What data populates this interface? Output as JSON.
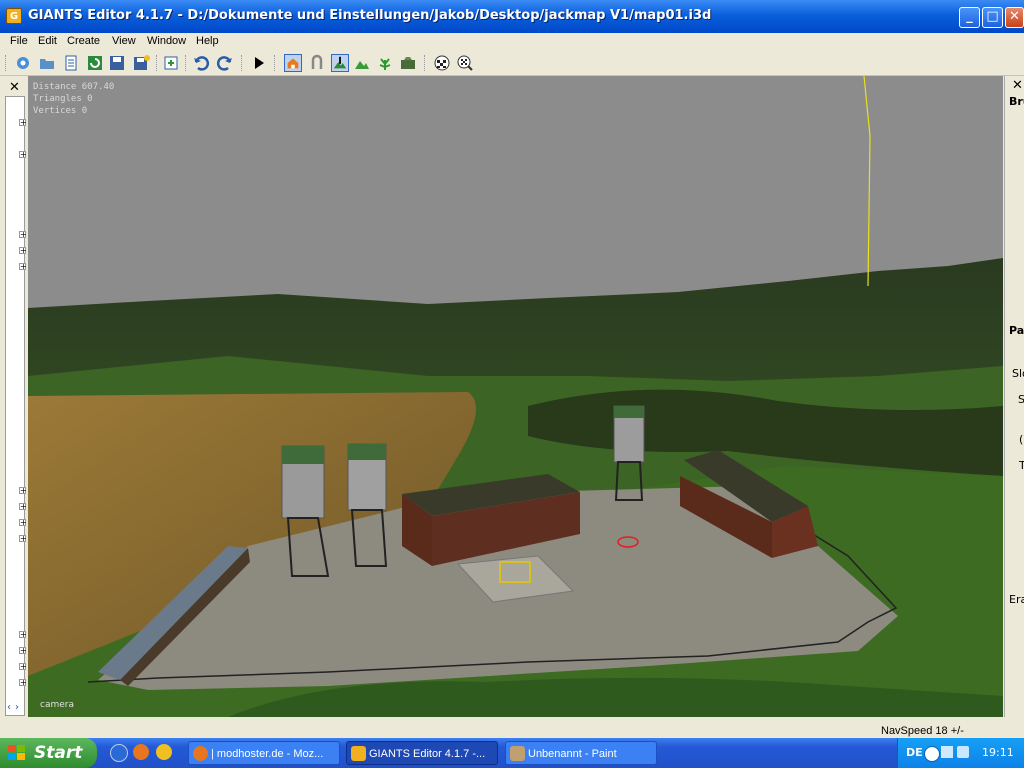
{
  "window": {
    "title": "GIANTS Editor 4.1.7 - D:/Dokumente und Einstellungen/Jakob/Desktop/jackmap V1/map01.i3d",
    "min": "_",
    "max": "□",
    "close": "✕",
    "app_icon_letter": "G"
  },
  "menu": [
    "File",
    "Edit",
    "Create",
    "View",
    "Window",
    "Help"
  ],
  "toolbar": {
    "icons": [
      "new-scene-icon",
      "open-icon",
      "properties-icon",
      "refresh-icon",
      "save-icon",
      "save-as-icon",
      "import-icon",
      "undo-icon",
      "redo-icon",
      "play-icon",
      "select-icon",
      "move-icon",
      "terrain-sculpt-icon",
      "terrain-paint-icon",
      "foliage-paint-icon",
      "terrain-detail-icon",
      "checker-icon",
      "search-checker-icon"
    ]
  },
  "left_panel": {
    "close": "✕",
    "scroll_up": "‹",
    "scroll_down": "›",
    "expanders": [
      "+",
      "+",
      "+",
      "+",
      "+",
      "+",
      "+",
      "+",
      "+",
      "+",
      "+",
      "+",
      "+"
    ]
  },
  "viewport": {
    "hud_distance": "Distance 607.40",
    "hud_triangles": "Triangles 0",
    "hud_vertices": "Vertices 0",
    "camera_label": "camera"
  },
  "right_panel": {
    "close": "✕",
    "labels": [
      "Bru",
      "Pa",
      "Slo",
      "S",
      "(",
      "T",
      "Era"
    ]
  },
  "status": {
    "navspeed": "NavSpeed 18 +/-"
  },
  "taskbar": {
    "start_label": "Start",
    "tasks": [
      {
        "label": "| modhoster.de - Moz...",
        "state": "inactive"
      },
      {
        "label": "GIANTS Editor 4.1.7 -...",
        "state": "active"
      },
      {
        "label": "Unbenannt - Paint",
        "state": "inactive"
      }
    ],
    "language": "DE",
    "time": "19:11"
  },
  "colors": {
    "sky": "#8c8c8c",
    "grass": "#3f6a23",
    "field": "#8a6a2c",
    "yard": "#8d8a80"
  }
}
